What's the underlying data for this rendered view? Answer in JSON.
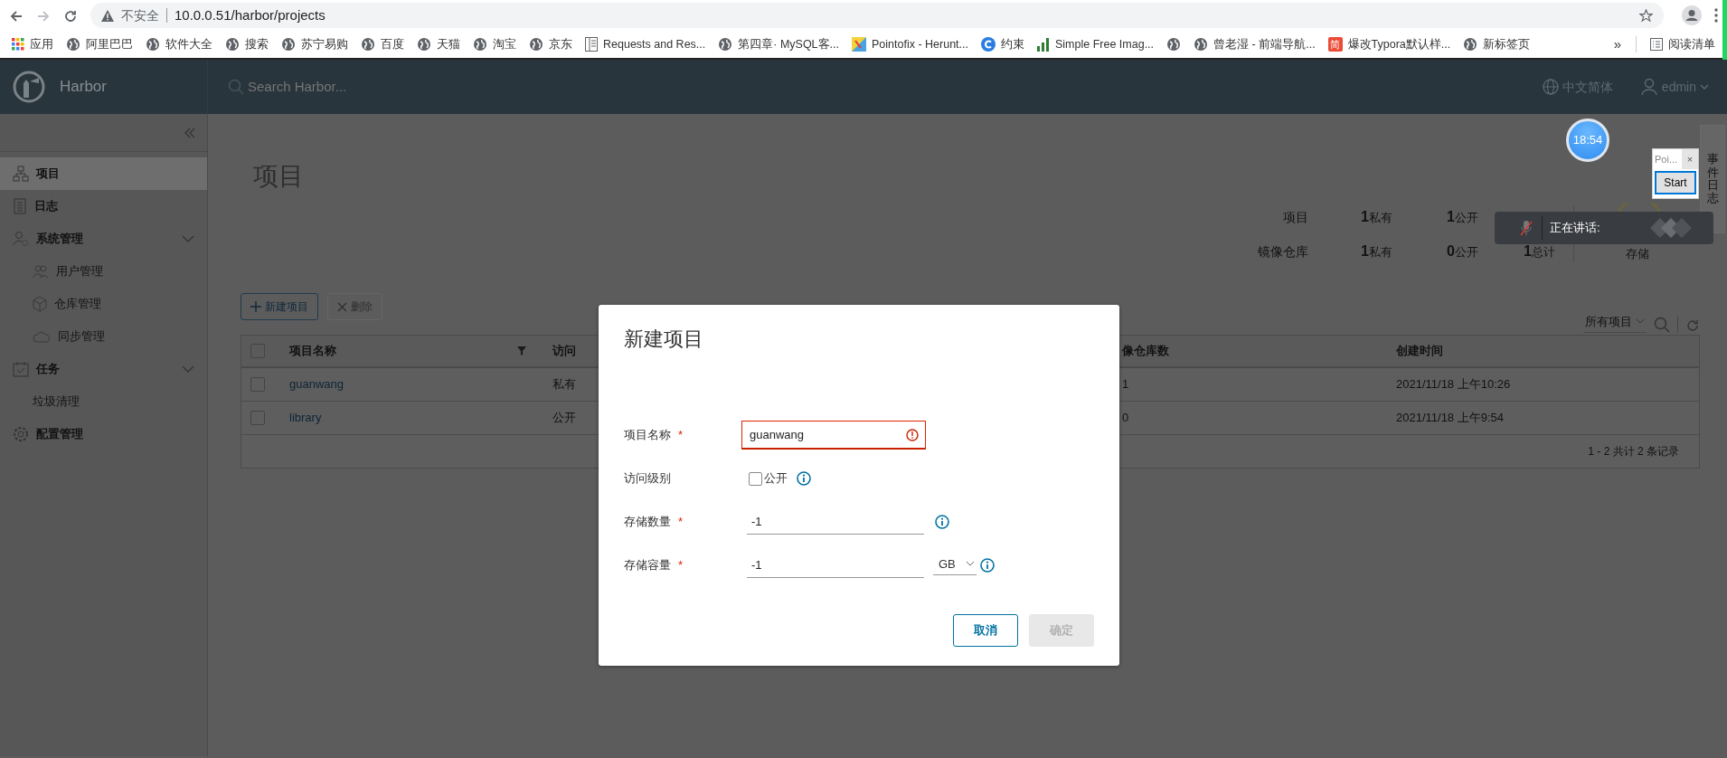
{
  "browser": {
    "warning": "不安全",
    "url": "10.0.0.51/harbor/projects",
    "bookmarks": [
      {
        "kind": "link",
        "label": "应用"
      },
      {
        "kind": "link",
        "label": "阿里巴巴"
      },
      {
        "kind": "link",
        "label": "软件大全"
      },
      {
        "kind": "link",
        "label": "搜索"
      },
      {
        "kind": "link",
        "label": "苏宁易购"
      },
      {
        "kind": "link",
        "label": "百度"
      },
      {
        "kind": "link",
        "label": "天猫"
      },
      {
        "kind": "link",
        "label": "淘宝"
      },
      {
        "kind": "link",
        "label": "京东"
      },
      {
        "kind": "link",
        "label": "Requests and Res..."
      },
      {
        "kind": "link",
        "label": "第四章· MySQL客..."
      },
      {
        "kind": "link",
        "label": "Pointofix - Herunt..."
      },
      {
        "kind": "link",
        "label": "约束"
      },
      {
        "kind": "link",
        "label": "Simple Free Imag..."
      },
      {
        "kind": "icon_only"
      },
      {
        "kind": "link",
        "label": "曾老湿 - 前端导航..."
      },
      {
        "kind": "badge",
        "badge": "简",
        "label": "爆改Typora默认样..."
      },
      {
        "kind": "link",
        "label": "新标签页"
      }
    ],
    "overflow": "»",
    "reading_list": "阅读清单"
  },
  "header": {
    "brand": "Harbor",
    "search_placeholder": "Search Harbor...",
    "language": "中文简体",
    "user": "edmin"
  },
  "sidebar": {
    "items": [
      {
        "label": "项目",
        "selected": true
      },
      {
        "label": "日志",
        "selected": false
      },
      {
        "label": "系统管理",
        "selected": false,
        "expanded": true,
        "children": [
          {
            "label": "用户管理",
            "selected": false
          },
          {
            "label": "仓库管理",
            "selected": false
          },
          {
            "label": "同步管理",
            "selected": false
          }
        ]
      },
      {
        "label": "任务",
        "selected": false,
        "expanded": true,
        "children": [
          {
            "label": "垃圾清理",
            "selected": false
          }
        ]
      },
      {
        "label": "配置管理",
        "selected": false
      }
    ]
  },
  "page": {
    "title": "项目",
    "stats": {
      "rows": [
        {
          "label": "项目",
          "values": [
            {
              "value": "1",
              "unit": "私有"
            },
            {
              "value": "1",
              "unit": "公开"
            }
          ]
        },
        {
          "label": "镜像仓库",
          "values": [
            {
              "value": "1",
              "unit": "私有"
            },
            {
              "value": "0",
              "unit": "公开"
            },
            {
              "value": "1",
              "unit": "总计"
            }
          ]
        }
      ],
      "storage_label": "存储"
    },
    "actions": [
      {
        "label": "新建项目",
        "disabled": false
      },
      {
        "label": "删除",
        "disabled": true
      }
    ],
    "filter": "所有项目",
    "table": {
      "columns": [
        {
          "label": "项目名称",
          "filter": true
        },
        {
          "label": "访问",
          "filter": false
        },
        {
          "label": "像仓库数",
          "filter": false
        },
        {
          "label": "创建时间",
          "filter": false
        }
      ],
      "rows": [
        {
          "checked": false,
          "cells": [
            "guanwang",
            "私有",
            "1",
            "2021/11/18 上午10:26"
          ]
        },
        {
          "checked": false,
          "cells": [
            "library",
            "公开",
            "0",
            "2021/11/18 上午9:54"
          ]
        }
      ],
      "footer": "1 - 2 共计 2 条记录",
      "select_all_checked": false
    }
  },
  "modal": {
    "title": "新建项目",
    "fields": [
      {
        "kind": "text",
        "label": "项目名称",
        "mark": "*",
        "value": "guanwang",
        "invalid": true,
        "info": false
      },
      {
        "kind": "checkbox",
        "label": "访问级别",
        "option": "公开",
        "checked": false,
        "info": true
      },
      {
        "kind": "text",
        "label": "存储数量",
        "mark": "*",
        "value": "-1",
        "invalid": false,
        "info": true
      },
      {
        "kind": "text_unit",
        "label": "存储容量",
        "mark": "*",
        "value": "-1",
        "unit": "GB",
        "invalid": false,
        "info": true
      }
    ],
    "buttons": [
      {
        "label": "取消",
        "disabled": false
      },
      {
        "label": "确定",
        "disabled": true
      }
    ]
  },
  "overlays": {
    "clock": "18:54",
    "mini_window": {
      "title": "Poi...",
      "close": "×",
      "button": "Start"
    },
    "side_tab": "事件日志",
    "toast": "正在讲话:"
  }
}
